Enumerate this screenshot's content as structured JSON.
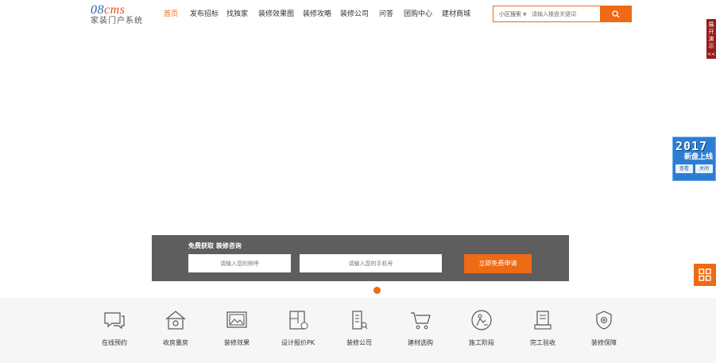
{
  "logo": {
    "top_part1": "08",
    "top_part2": "cms",
    "subtitle": "家装门户系统"
  },
  "nav": {
    "items": [
      {
        "label": "首页",
        "active": true
      },
      {
        "label": "发布招标",
        "active": false
      },
      {
        "label": "找独家",
        "active": false
      },
      {
        "label": "装修效果图",
        "active": false
      },
      {
        "label": "装修攻略",
        "active": false
      },
      {
        "label": "装修公司",
        "active": false
      },
      {
        "label": "问答",
        "active": false
      },
      {
        "label": "团购中心",
        "active": false
      },
      {
        "label": "建材商城",
        "active": false
      }
    ]
  },
  "search": {
    "category": "小区搜索",
    "placeholder": "请输入楼盘关键词",
    "button_icon": "search-icon"
  },
  "side": {
    "demo_label": "展开演示",
    "demo_arrow": "<<",
    "promo_year": "2017",
    "promo_text": "新盘上线",
    "promo_view": "查看",
    "promo_close": "关闭",
    "grid_icon": "grid-icon"
  },
  "consult": {
    "title": "免费获取 装修咨询",
    "name_placeholder": "请输入您的称呼",
    "phone_placeholder": "请输入您的手机号",
    "button": "立即免费申请"
  },
  "services": [
    {
      "label": "在线预约",
      "icon": "chat-bubble-icon"
    },
    {
      "label": "收房量房",
      "icon": "house-icon"
    },
    {
      "label": "装修效果",
      "icon": "picture-icon"
    },
    {
      "label": "设计报价PK",
      "icon": "floorplan-icon"
    },
    {
      "label": "装修公司",
      "icon": "building-icon"
    },
    {
      "label": "建材选购",
      "icon": "cart-icon"
    },
    {
      "label": "施工阶段",
      "icon": "worker-icon"
    },
    {
      "label": "完工验收",
      "icon": "document-icon"
    },
    {
      "label": "装修保障",
      "icon": "shield-icon"
    }
  ],
  "colors": {
    "accent": "#ef6a14",
    "brand_blue": "#2b63b5",
    "consult_bg": "#505050",
    "strip_bg": "#f6f6f6"
  }
}
